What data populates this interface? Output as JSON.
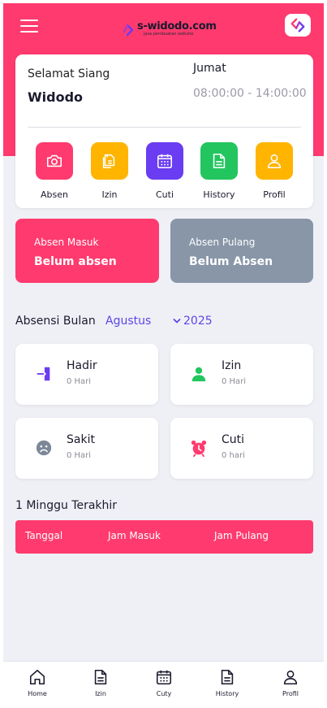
{
  "header": {
    "logo_title": "s-widodo.com",
    "logo_subtitle": "jasa pembuatan website"
  },
  "greeting": {
    "salutation": "Selamat Siang",
    "name": "Widodo",
    "day": "Jumat",
    "hours": "08:00:00 - 14:00:00"
  },
  "menu": [
    {
      "label": "Absen",
      "icon": "camera-icon",
      "color": "#ff3a6e"
    },
    {
      "label": "Izin",
      "icon": "documents-icon",
      "color": "#ffb400"
    },
    {
      "label": "Cuti",
      "icon": "calendar-icon",
      "color": "#6a3cf2"
    },
    {
      "label": "History",
      "icon": "document-icon",
      "color": "#22c55e"
    },
    {
      "label": "Profil",
      "icon": "user-icon",
      "color": "#ffb400"
    }
  ],
  "attendance": {
    "in": {
      "title": "Absen Masuk",
      "value": "Belum absen",
      "color": "#ff3a6e"
    },
    "out": {
      "title": "Absen Pulang",
      "value": "Belum Absen",
      "color": "#8896a8"
    }
  },
  "monthly": {
    "title": "Absensi Bulan",
    "month": "Agustus",
    "year": "2025"
  },
  "stats": [
    {
      "label": "Hadir",
      "value": "0 Hari",
      "icon": "login-icon",
      "color": "#6a3cf2"
    },
    {
      "label": "Izin",
      "value": "0 Hari",
      "icon": "user-icon",
      "color": "#22c55e"
    },
    {
      "label": "Sakit",
      "value": "0 Hari",
      "icon": "sad-face-icon",
      "color": "#7c8898"
    },
    {
      "label": "Cuti",
      "value": "0 hari",
      "icon": "alarm-clock-icon",
      "color": "#ff3a6e"
    }
  ],
  "weekly": {
    "title": "1 Minggu Terakhir",
    "columns": [
      "Tanggal",
      "Jam Masuk",
      "Jam Pulang"
    ]
  },
  "bottom_nav": [
    {
      "label": "Home",
      "icon": "home-icon"
    },
    {
      "label": "Izin",
      "icon": "document-icon"
    },
    {
      "label": "Cuty",
      "icon": "calendar-icon"
    },
    {
      "label": "History",
      "icon": "document-icon"
    },
    {
      "label": "Profil",
      "icon": "user-icon"
    }
  ]
}
